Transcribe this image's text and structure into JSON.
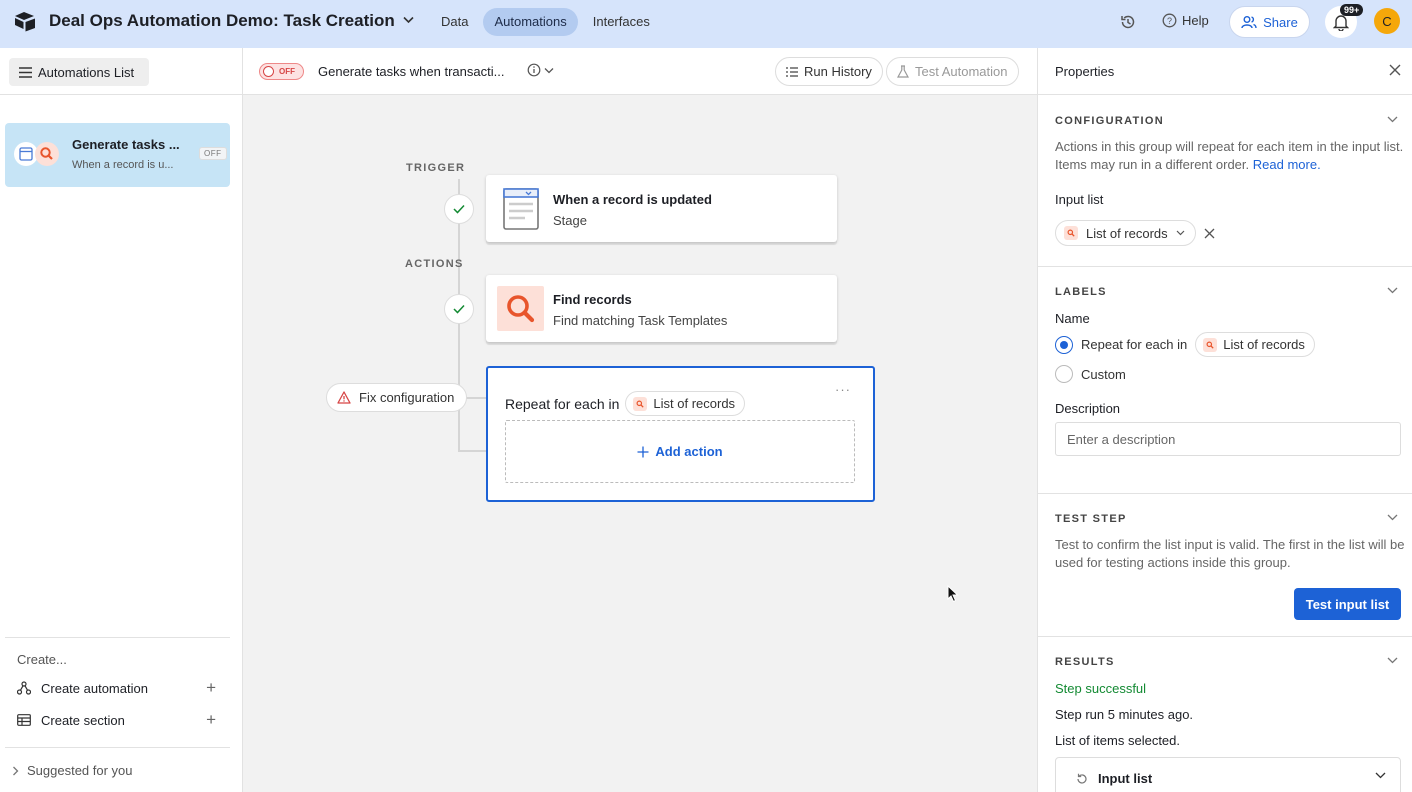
{
  "topbar": {
    "base_title": "Deal Ops Automation Demo: Task Creation",
    "tabs": [
      "Data",
      "Automations",
      "Interfaces"
    ],
    "active_tab": "Automations",
    "help_label": "Help",
    "share_label": "Share",
    "notification_badge": "99+",
    "avatar_initial": "C"
  },
  "sidebar": {
    "list_button": "Automations List",
    "automation": {
      "title": "Generate tasks ...",
      "subtitle": "When a record is u...",
      "status": "OFF"
    },
    "create_label": "Create...",
    "create_automation": "Create automation",
    "create_section": "Create section",
    "suggested": "Suggested for you"
  },
  "editor": {
    "toggle_label": "OFF",
    "automation_name": "Generate tasks when transacti...",
    "run_history": "Run History",
    "test_automation": "Test Automation"
  },
  "canvas": {
    "trigger_label": "TRIGGER",
    "actions_label": "ACTIONS",
    "trigger_card": {
      "title": "When a record is updated",
      "subtitle": "Stage"
    },
    "find_card": {
      "title": "Find records",
      "subtitle": "Find matching Task Templates"
    },
    "fix_config": "Fix configuration",
    "repeat": {
      "title": "Repeat for each in",
      "chip": "List of records",
      "add_action": "Add action"
    }
  },
  "panel": {
    "title": "Properties",
    "configuration": {
      "heading": "CONFIGURATION",
      "text": "Actions in this group will repeat for each item in the input list. Items may run in a different order.",
      "link": "Read more.",
      "input_list_label": "Input list",
      "input_list_value": "List of records"
    },
    "labels": {
      "heading": "LABELS",
      "name_label": "Name",
      "option_repeat": "Repeat for each in",
      "option_repeat_chip": "List of records",
      "option_custom": "Custom",
      "description_label": "Description",
      "description_placeholder": "Enter a description"
    },
    "test_step": {
      "heading": "TEST STEP",
      "text": "Test to confirm the list input is valid. The first in the list will be used for testing actions inside this group.",
      "button": "Test input list"
    },
    "results": {
      "heading": "RESULTS",
      "status": "Step successful",
      "run_time": "Step run 5 minutes ago.",
      "selected": "List of items selected.",
      "input_list": "Input list"
    }
  },
  "colors": {
    "topbar_bg": "#d6e4fb",
    "accent_blue": "#1d62d6",
    "selected_card_bg": "#c6e4f6",
    "success_green": "#138a33",
    "warning_red": "#d64545"
  }
}
